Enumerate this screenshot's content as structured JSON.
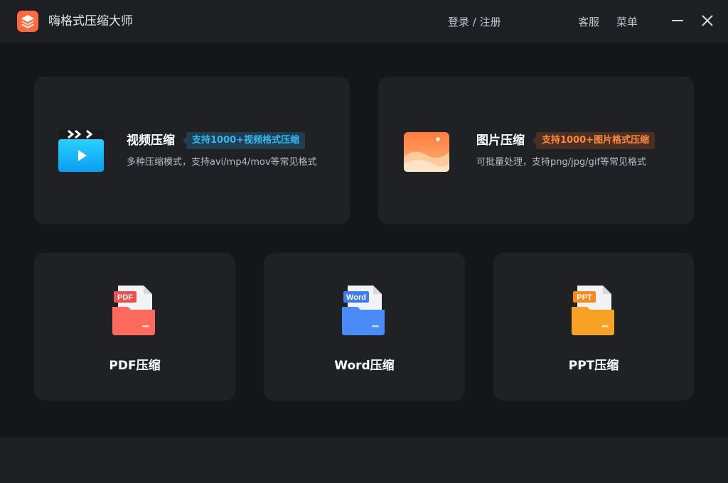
{
  "app": {
    "title": "嗨格式压缩大师",
    "login_label": "登录 / 注册",
    "service_label": "客服",
    "menu_label": "菜单"
  },
  "cards": {
    "video": {
      "title": "视频压缩",
      "badge": "支持1000+视频格式压缩",
      "desc": "多种压缩模式，支持avi/mp4/mov等常见格式",
      "icon": "video-clapper-icon"
    },
    "image": {
      "title": "图片压缩",
      "badge": "支持1000+图片格式压缩",
      "desc": "可批量处理，支持png/jpg/gif等常见格式",
      "icon": "picture-icon"
    },
    "pdf": {
      "title": "PDF压缩",
      "tag": "PDF",
      "icon": "pdf-folder-icon"
    },
    "word": {
      "title": "Word压缩",
      "tag": "Word",
      "icon": "word-folder-icon"
    },
    "ppt": {
      "title": "PPT压缩",
      "tag": "PPT",
      "icon": "ppt-folder-icon"
    }
  },
  "colors": {
    "accent_blue": "#35b8f0",
    "accent_orange": "#ff8a3d",
    "pdf_red": "#f0504a",
    "word_blue": "#3f7cf2",
    "ppt_orange": "#f7a224"
  }
}
